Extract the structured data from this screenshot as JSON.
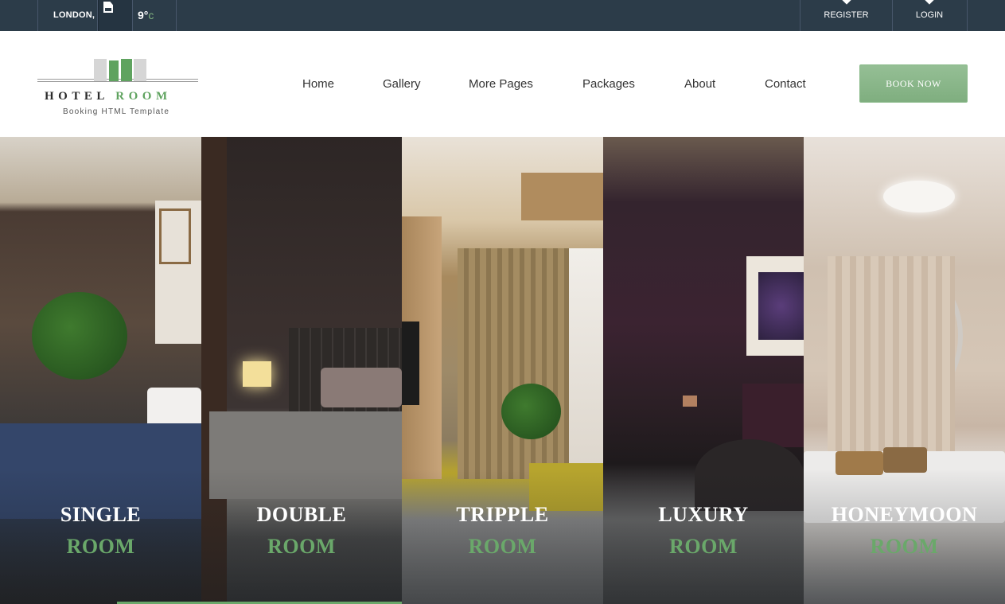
{
  "topbar": {
    "city": "LONDON,",
    "weather_icon": "weather-icon",
    "temperature": "9°",
    "temperature_unit": "c",
    "register": "REGISTER",
    "login": "LOGIN"
  },
  "header": {
    "logo": {
      "title_part1": "HOTEL",
      "title_part2": "ROOM",
      "subtitle": "Booking HTML Template"
    },
    "nav": [
      "Home",
      "Gallery",
      "More Pages",
      "Packages",
      "About",
      "Contact"
    ],
    "book_button": "BOOK NOW"
  },
  "rooms": [
    {
      "line1": "SINGLE",
      "line2": "ROOM"
    },
    {
      "line1": "DOUBLE",
      "line2": "ROOM"
    },
    {
      "line1": "TRIPPLE",
      "line2": "ROOM"
    },
    {
      "line1": "LUXURY",
      "line2": "ROOM"
    },
    {
      "line1": "HONEYMOON",
      "line2": "ROOM"
    }
  ],
  "colors": {
    "topbar_bg": "#2c3c49",
    "accent_green": "#6aa86a",
    "button_green": "#8ab88a"
  }
}
